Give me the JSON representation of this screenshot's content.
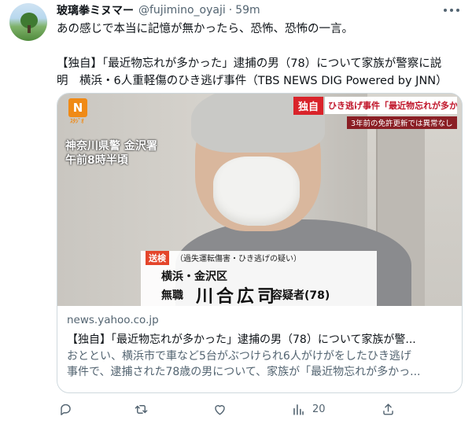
{
  "tweet": {
    "display_name": "玻璃拳ミヌマー",
    "handle": "@fujimino_oyaji",
    "separator": "·",
    "time": "59m",
    "text_line1": "あの感じで本当に記憶が無かったら、恐怖、恐怖の一言。",
    "text_line2": "【独自】「最近物忘れが多かった」逮捕の男（78）について家族が警察に説",
    "text_line3": "明　横浜・6人重軽傷のひき逃げ事件（TBS NEWS DIG Powered by JNN）"
  },
  "card": {
    "domain": "news.yahoo.co.jp",
    "title": "【独自】「最近物忘れが多かった」逮捕の男（78）について家族が警...",
    "desc_line1": "おととい、横浜市で車など5台がぶつけられ6人がけがをしたひき逃げ",
    "desc_line2": "事件で、逮捕された78歳の男について、家族が「最近物忘れが多かっ...",
    "image": {
      "logo_letter": "N",
      "logo_sub": "ｽﾀｼﾞｵ",
      "police_line1": "神奈川県警 金沢署",
      "police_line2": "午前8時半頃",
      "tag_exclusive": "独自",
      "tag_headline": "ひき逃げ事件「最近物忘れが多かった」",
      "tag_sub": "3年前の免許更新では異常なし",
      "caption_label": "送検",
      "caption_note": "（過失運転傷害・ひき逃げの疑い）",
      "caption_area": "横浜・金沢区",
      "caption_job": "無職",
      "caption_name": "川合広司",
      "caption_title": "容疑者(78)"
    }
  },
  "actions": {
    "reply_icon": "reply-icon",
    "retweet_icon": "retweet-icon",
    "like_icon": "like-icon",
    "views_icon": "views-icon",
    "views_count": "20",
    "share_icon": "share-icon"
  },
  "colors": {
    "text": "#0f1419",
    "secondary": "#536471",
    "border": "#cfd9de",
    "tag_red": "#d9232a"
  }
}
